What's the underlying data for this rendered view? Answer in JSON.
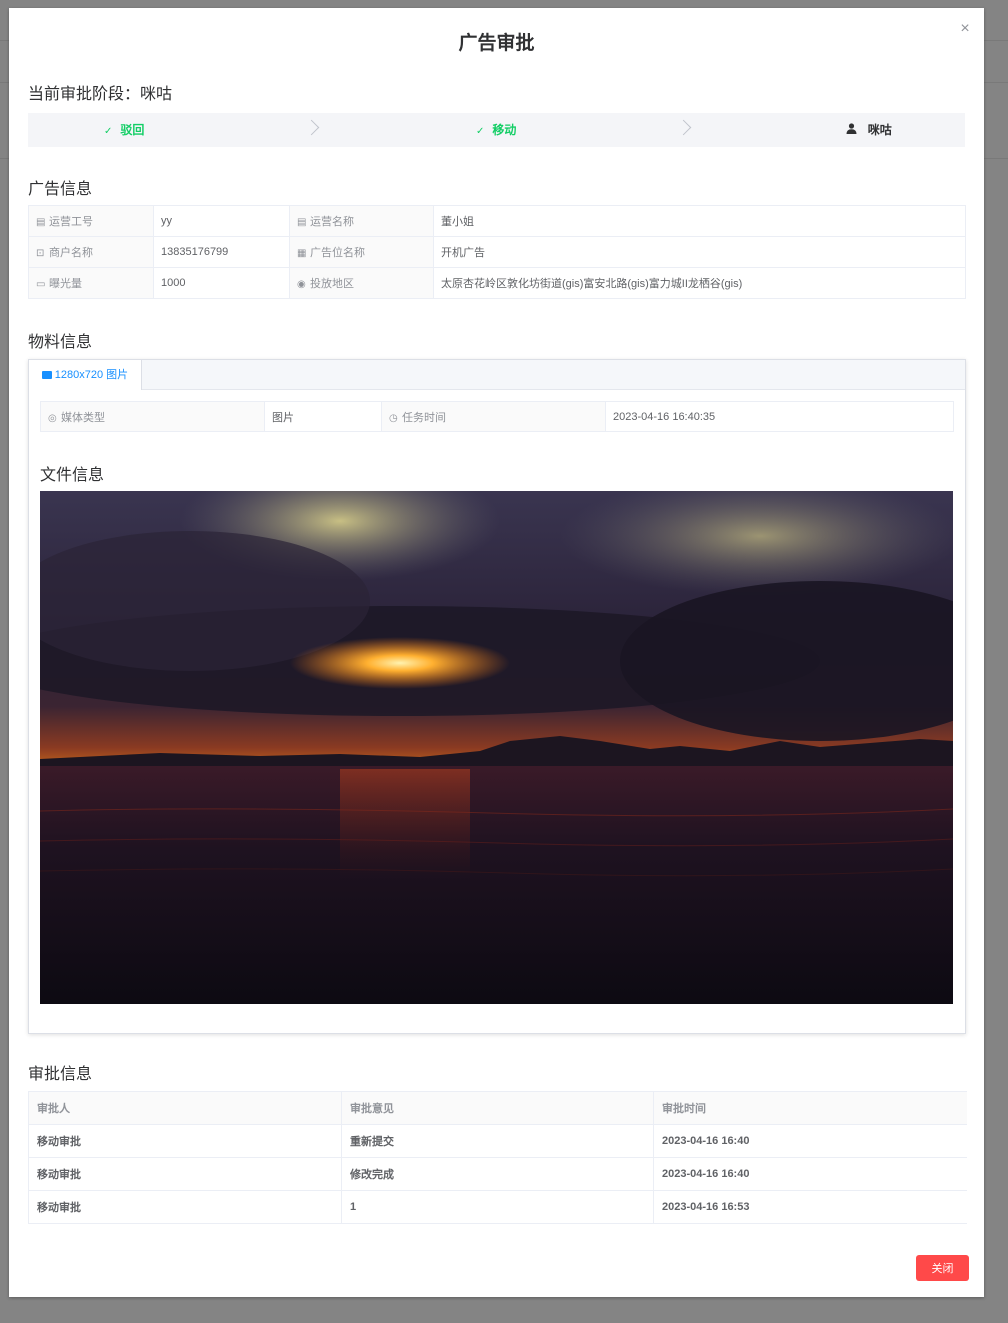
{
  "dialog": {
    "title": "广告审批",
    "close_icon": "×"
  },
  "stage": {
    "label": "当前审批阶段：",
    "value": "咪咕"
  },
  "steps": [
    {
      "label": "驳回",
      "status": "done",
      "icon": "check-icon"
    },
    {
      "label": "移动",
      "status": "done",
      "icon": "check-icon"
    },
    {
      "label": "咪咕",
      "status": "active",
      "icon": "user-icon"
    }
  ],
  "ad_info": {
    "title": "广告信息",
    "rows": [
      [
        {
          "label": "运营工号",
          "value": "yy"
        },
        {
          "label": "运营名称",
          "value": "董小姐"
        }
      ],
      [
        {
          "label": "商户名称",
          "value": "13835176799"
        },
        {
          "label": "广告位名称",
          "value": "开机广告"
        }
      ],
      [
        {
          "label": "曝光量",
          "value": "1000"
        },
        {
          "label": "投放地区",
          "value": "太原杏花岭区敦化坊街道(gis)富安北路(gis)富力城II龙栖谷(gis)"
        }
      ]
    ]
  },
  "material": {
    "title": "物料信息",
    "tab_label": "1280x720 图片",
    "media_type_label": "媒体类型",
    "media_type_value": "图片",
    "task_time_label": "任务时间",
    "task_time_value": "2023-04-16 16:40:35",
    "file_title": "文件信息"
  },
  "approval": {
    "title": "审批信息",
    "headers": [
      "审批人",
      "审批意见",
      "审批时间"
    ],
    "rows": [
      [
        "移动审批",
        "重新提交",
        "2023-04-16 16:40"
      ],
      [
        "移动审批",
        "修改完成",
        "2023-04-16 16:40"
      ],
      [
        "移动审批",
        "1",
        "2023-04-16 16:53"
      ]
    ]
  },
  "footer": {
    "close_label": "关闭"
  },
  "colors": {
    "success": "#13ce66",
    "primary": "#1890ff",
    "danger": "#ff4949"
  }
}
